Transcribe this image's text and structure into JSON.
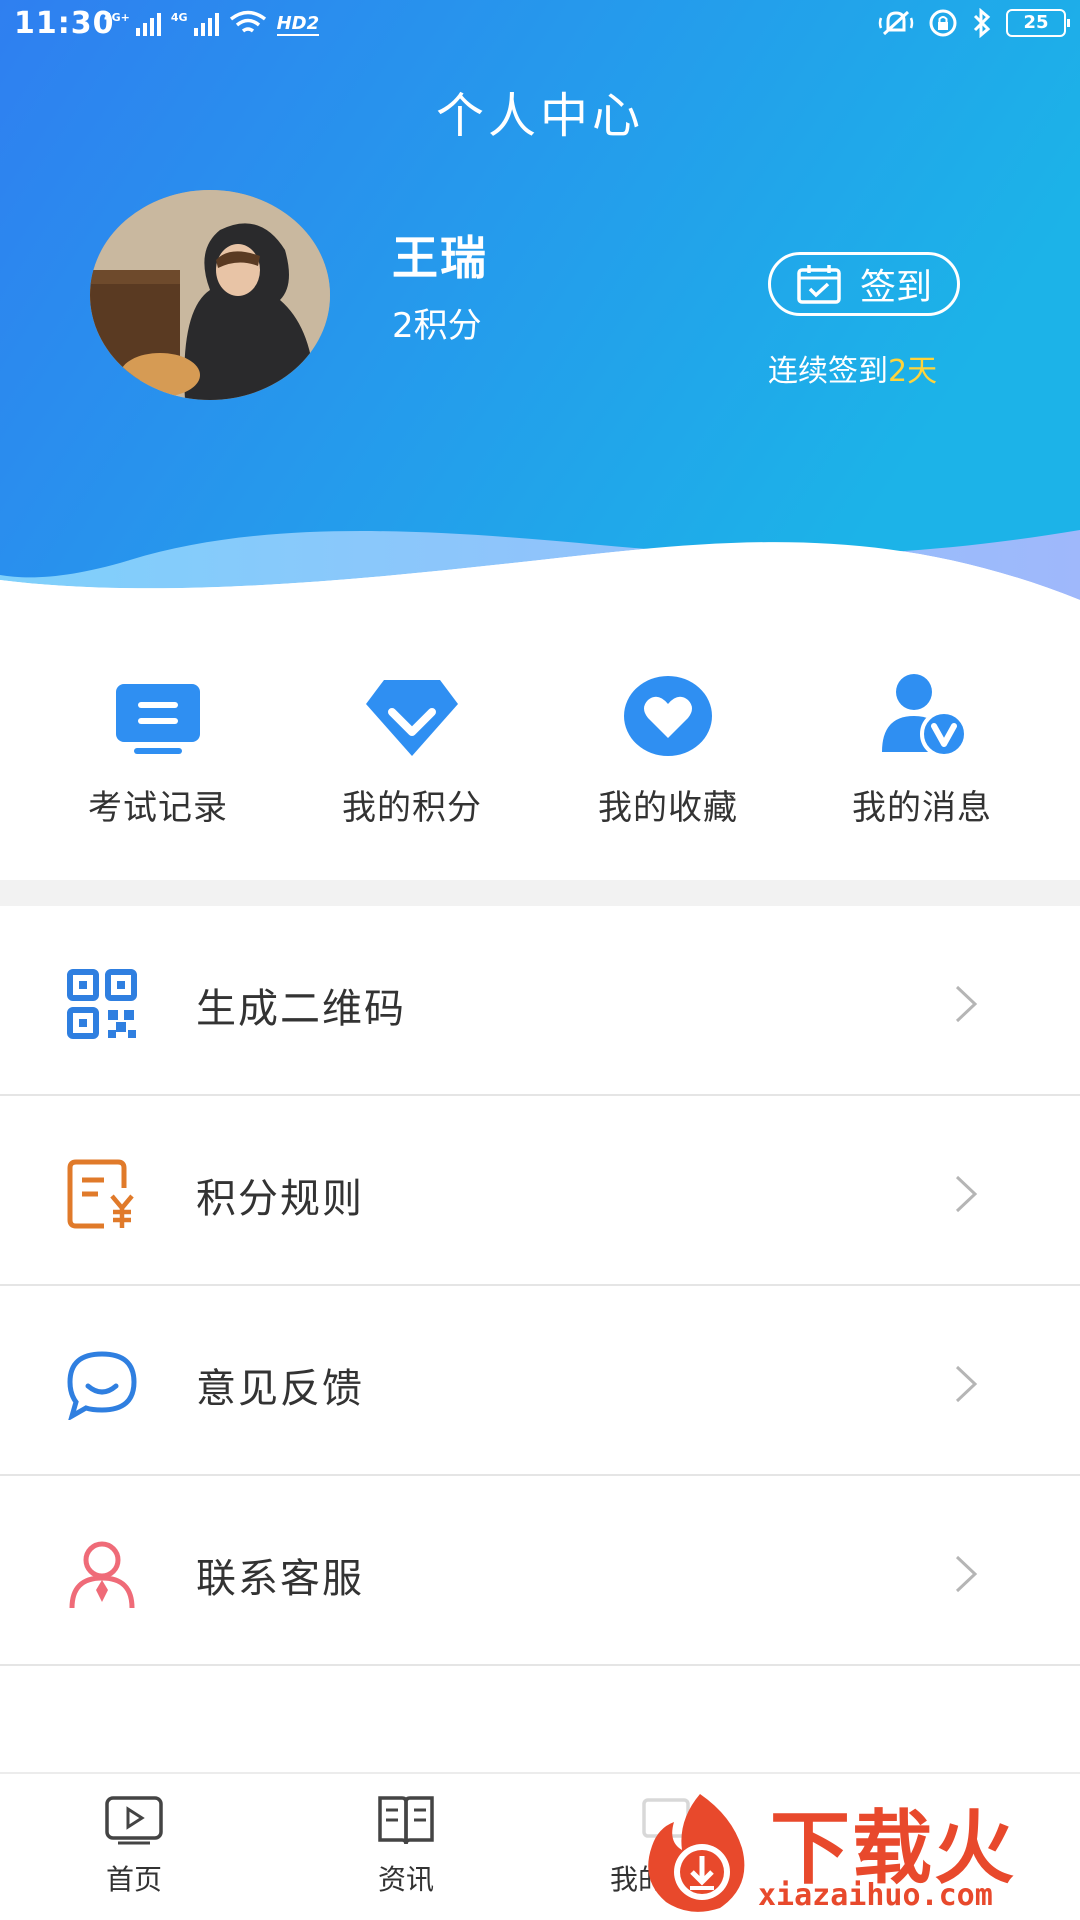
{
  "status_bar": {
    "time": "11:30",
    "network_1": "4G+",
    "network_2": "4G",
    "hd_label": "HD2",
    "battery": "25"
  },
  "header": {
    "title": "个人中心"
  },
  "profile": {
    "name": "王瑞",
    "points": "2积分",
    "checkin_label": "签到",
    "streak_prefix": "连续签到",
    "streak_days": "2天"
  },
  "quick_actions": [
    {
      "label": "考试记录",
      "icon": "exam-record-icon"
    },
    {
      "label": "我的积分",
      "icon": "diamond-icon"
    },
    {
      "label": "我的收藏",
      "icon": "heart-icon"
    },
    {
      "label": "我的消息",
      "icon": "user-message-icon"
    }
  ],
  "menu": [
    {
      "label": "生成二维码",
      "icon": "qr-code-icon"
    },
    {
      "label": "积分规则",
      "icon": "points-rule-icon"
    },
    {
      "label": "意见反馈",
      "icon": "chat-bubble-icon"
    },
    {
      "label": "联系客服",
      "icon": "customer-service-icon"
    }
  ],
  "tabbar": {
    "home": "首页",
    "news": "资讯",
    "mine": "我的学习"
  },
  "watermark": {
    "brand": "下载火",
    "url": "xiazaihuo.com"
  },
  "colors": {
    "header_gradient_start": "#2f7ff0",
    "header_gradient_end": "#1cb3e8",
    "icon_blue": "#2f8ff2",
    "icon_orange": "#e07a2a",
    "icon_pink": "#ef6b78",
    "streak_days": "#ffd43b"
  }
}
